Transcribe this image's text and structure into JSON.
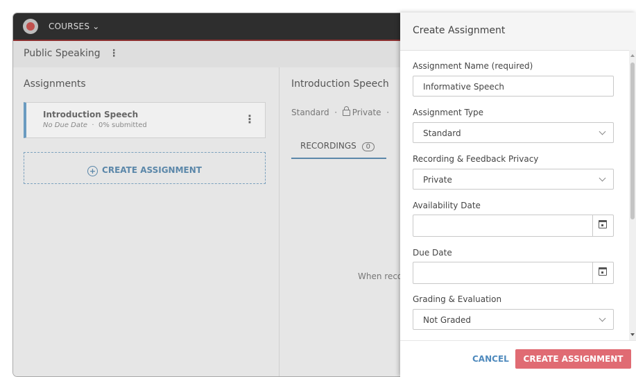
{
  "topbar": {
    "courses_label": "COURSES",
    "courses_chevron": "⌄"
  },
  "breadcrumb": {
    "title": "Public Speaking",
    "menu_glyph": "⋮"
  },
  "left_pane": {
    "title": "Assignments",
    "assignment": {
      "name": "Introduction Speech",
      "due": "No Due Date",
      "separator": "·",
      "submitted": "0% submitted"
    },
    "create_label": "CREATE ASSIGNMENT",
    "create_icon": "plus-circle-icon"
  },
  "right_pane": {
    "title": "Introduction Speech",
    "meta_type": "Standard",
    "meta_sep": "·",
    "meta_privacy": "Private",
    "tab_label": "RECORDINGS",
    "tab_count": "0",
    "empty_text": "When record"
  },
  "drawer": {
    "title": "Create Assignment",
    "fields": {
      "name_label": "Assignment Name (required)",
      "name_value": "Informative Speech",
      "type_label": "Assignment Type",
      "type_value": "Standard",
      "privacy_label": "Recording & Feedback Privacy",
      "privacy_value": "Private",
      "availability_label": "Availability Date",
      "availability_value": "",
      "due_label": "Due Date",
      "due_value": "",
      "grading_label": "Grading & Evaluation",
      "grading_value": "Not Graded"
    },
    "cancel_label": "CANCEL",
    "create_label": "CREATE ASSIGNMENT"
  },
  "colors": {
    "accent": "#5b87a9",
    "primary_button": "#e06b73",
    "topbar": "#2e2e2e"
  }
}
